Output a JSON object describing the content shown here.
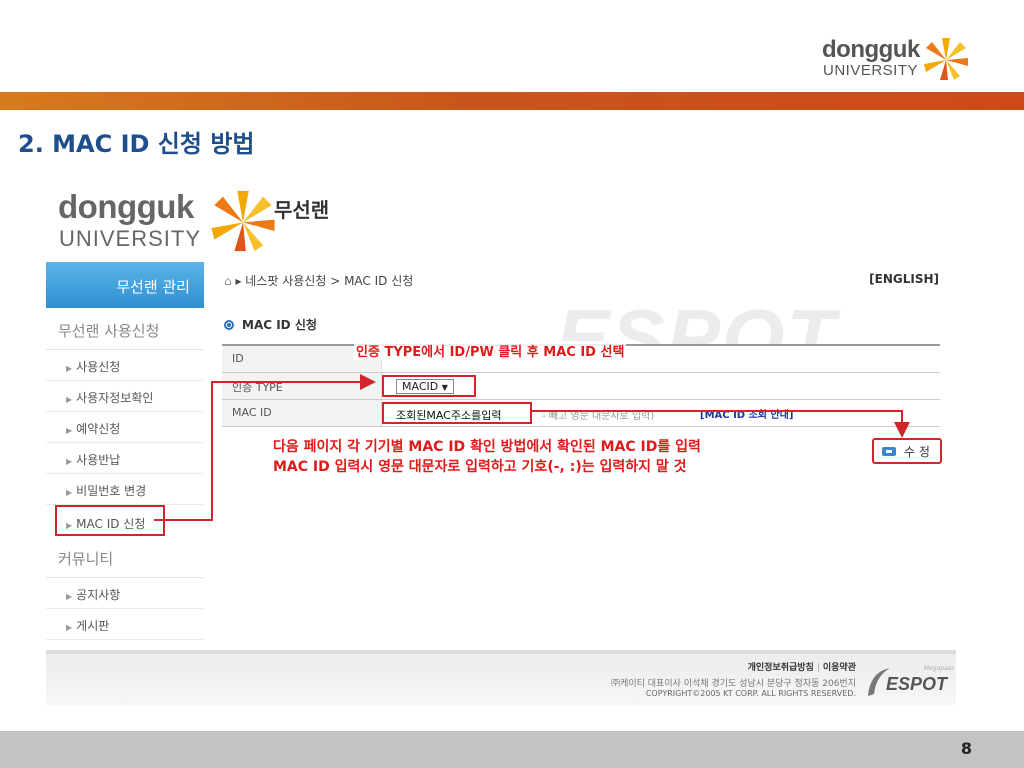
{
  "slide": {
    "logo_word1": "dongguk",
    "logo_word2": "UNIVERSITY",
    "title": "2. MAC ID 신청 방법",
    "page_number": "8"
  },
  "site": {
    "logo_word1": "dongguk",
    "logo_word2": "UNIVERSITY",
    "name": "무선랜",
    "watermark": "ESPOT",
    "breadcrumb": "▸ 네스팟 사용신청 > MAC ID 신청",
    "english_link": "[ENGLISH]"
  },
  "sidebar": {
    "header": "무선랜 관리",
    "section1": "무선랜 사용신청",
    "items1": [
      "사용신청",
      "사용자정보확인",
      "예약신청",
      "사용반납",
      "비밀번호 변경",
      "MAC ID 신청"
    ],
    "section2": "커뮤니티",
    "items2": [
      "공지사항",
      "게시판"
    ]
  },
  "form": {
    "section_title": "MAC ID 신청",
    "row_id_label": "ID",
    "row_auth_label": "인증 TYPE",
    "auth_value": "MACID",
    "row_mac_label": "MAC ID",
    "mac_value": "조회된MAC주소를입력",
    "mac_hint": "- 빼고 영문 대문자로 입력)",
    "mac_guide": "[MAC ID 조회 안내]",
    "edit_label": "수 정"
  },
  "annotations": {
    "note1": "인증 TYPE에서 ID/PW 클릭 후 MAC ID 선택",
    "note2_line1": "다음 페이지 각 기기별 MAC ID 확인 방법에서 확인된 MAC ID를 입력",
    "note2_line2": "MAC ID 입력시 영문 대문자로 입력하고 기호(-, :)는 입력하지 말 것"
  },
  "footer": {
    "privacy": "개인정보취급방침",
    "terms": "이용약관",
    "address": "㈜케이티 대표이사 이석채 경기도 성남시 분당구 정자동 206번지",
    "copyright": "COPYRIGHT©2005 KT CORP. ALL RIGHTS RESERVED.",
    "logo_tag": "Megapass",
    "logo_word": "ESPOT"
  },
  "colors": {
    "title_blue": "#1f4e8c",
    "annotation_red": "#e01a1a",
    "highlight_border": "#d0262b",
    "orange_bar": "#cf4a17"
  }
}
